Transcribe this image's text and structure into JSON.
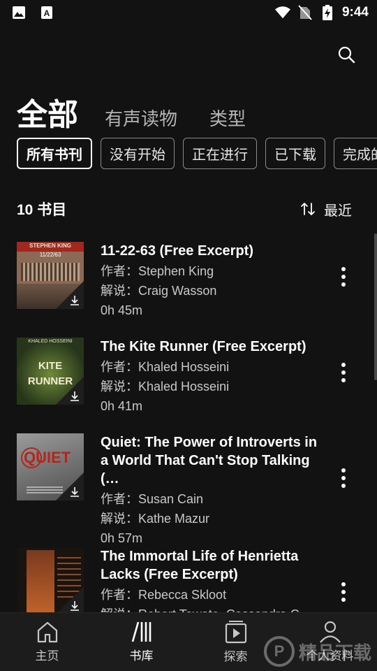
{
  "statusbar": {
    "time": "9:44",
    "left_icons": [
      "image-icon",
      "text-a-icon"
    ],
    "right_icons": [
      "wifi-icon",
      "no-sim-icon",
      "battery-charging-icon"
    ]
  },
  "header": {
    "search_icon": "search-icon"
  },
  "tabs": [
    {
      "label": "全部",
      "active": true
    },
    {
      "label": "有声读物",
      "active": false
    },
    {
      "label": "类型",
      "active": false
    }
  ],
  "filters": [
    {
      "label": "所有书刊",
      "active": true
    },
    {
      "label": "没有开始",
      "active": false
    },
    {
      "label": "正在进行",
      "active": false
    },
    {
      "label": "已下载",
      "active": false
    },
    {
      "label": "完成的",
      "active": false
    }
  ],
  "list_header": {
    "count": "10 书目",
    "sort_label": "最近",
    "sort_icon": "sort-icon"
  },
  "books": [
    {
      "title": "11-22-63 (Free Excerpt)",
      "author": "作者：Stephen King",
      "narrator": "解说：Craig Wasson",
      "duration": "0h 45m",
      "cover_top": "STEPHEN KING",
      "cover_sub": "11/22/63"
    },
    {
      "title": "The Kite Runner (Free Excerpt)",
      "author": "作者：Khaled Hosseini",
      "narrator": "解说：Khaled Hosseini",
      "duration": "0h 41m",
      "cover_top": "KHALED HOSSEINI",
      "cover_sub": "KITE RUNNER"
    },
    {
      "title": "Quiet: The Power of Introverts in a World That Can't Stop Talking (…",
      "author": "作者：Susan Cain",
      "narrator": "解说：Kathe Mazur",
      "duration": "0h 57m",
      "cover_top": "",
      "cover_sub": "QUIET"
    },
    {
      "title": "The Immortal Life of Henrietta Lacks (Free Excerpt)",
      "author": "作者：Rebecca Skloot",
      "narrator": "解说：Robert Tawate, Cassandra C…",
      "duration": "",
      "cover_top": "",
      "cover_sub": ""
    }
  ],
  "bottom_nav": [
    {
      "label": "主页",
      "icon": "home-icon",
      "active": false
    },
    {
      "label": "书库",
      "icon": "library-icon",
      "active": true
    },
    {
      "label": "探索",
      "icon": "explore-play-icon",
      "active": false
    },
    {
      "label": "个人资料",
      "icon": "profile-icon",
      "active": false
    }
  ],
  "watermark": "精品下载",
  "colors": {
    "background": "#121212",
    "nav_background": "#1c1c1c",
    "text_secondary": "#c9c9c9"
  }
}
